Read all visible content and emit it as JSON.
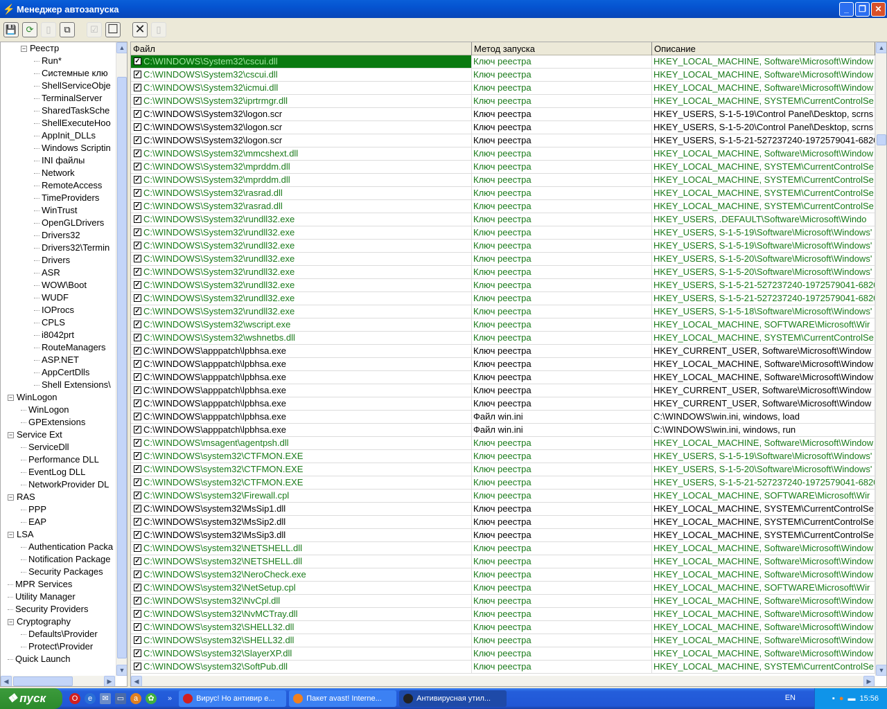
{
  "window": {
    "title": "Менеджер автозапуска",
    "controls": [
      "_",
      "❐",
      "✕"
    ]
  },
  "toolbar": {
    "icons": [
      "save-icon",
      "refresh-icon",
      "new-icon",
      "copy-icon",
      "check-icon",
      "uncheck-icon",
      "delete-icon",
      "properties-icon"
    ]
  },
  "tree": [
    {
      "label": "Реестр",
      "level": 1,
      "exp": "−"
    },
    {
      "label": "Run*",
      "level": 2
    },
    {
      "label": "Системные клю",
      "level": 2
    },
    {
      "label": "ShellServiceObje",
      "level": 2
    },
    {
      "label": "TerminalServer",
      "level": 2
    },
    {
      "label": "SharedTaskSche",
      "level": 2
    },
    {
      "label": "ShellExecuteHoo",
      "level": 2
    },
    {
      "label": "AppInit_DLLs",
      "level": 2
    },
    {
      "label": "Windows Scriptin",
      "level": 2
    },
    {
      "label": "INI файлы",
      "level": 2
    },
    {
      "label": "Network",
      "level": 2
    },
    {
      "label": "RemoteAccess",
      "level": 2
    },
    {
      "label": "TimeProviders",
      "level": 2
    },
    {
      "label": "WinTrust",
      "level": 2
    },
    {
      "label": "OpenGLDrivers",
      "level": 2
    },
    {
      "label": "Drivers32",
      "level": 2
    },
    {
      "label": "Drivers32\\Termin",
      "level": 2
    },
    {
      "label": "Drivers",
      "level": 2
    },
    {
      "label": "ASR",
      "level": 2
    },
    {
      "label": "WOW\\Boot",
      "level": 2
    },
    {
      "label": "WUDF",
      "level": 2
    },
    {
      "label": "IOProcs",
      "level": 2
    },
    {
      "label": "CPLS",
      "level": 2
    },
    {
      "label": "i8042prt",
      "level": 2
    },
    {
      "label": "RouteManagers",
      "level": 2
    },
    {
      "label": "ASP.NET",
      "level": 2
    },
    {
      "label": "AppCertDlls",
      "level": 2
    },
    {
      "label": "Shell Extensions\\",
      "level": 2
    },
    {
      "label": "WinLogon",
      "level": 0,
      "exp": "−"
    },
    {
      "label": "WinLogon",
      "level": 1
    },
    {
      "label": "GPExtensions",
      "level": 1
    },
    {
      "label": "Service Ext",
      "level": 0,
      "exp": "−"
    },
    {
      "label": "ServiceDll",
      "level": 1
    },
    {
      "label": "Performance DLL",
      "level": 1
    },
    {
      "label": "EventLog DLL",
      "level": 1
    },
    {
      "label": "NetworkProvider DL",
      "level": 1
    },
    {
      "label": "RAS",
      "level": 0,
      "exp": "−"
    },
    {
      "label": "PPP",
      "level": 1
    },
    {
      "label": "EAP",
      "level": 1
    },
    {
      "label": "LSA",
      "level": 0,
      "exp": "−"
    },
    {
      "label": "Authentication Packa",
      "level": 1
    },
    {
      "label": "Notification Package",
      "level": 1
    },
    {
      "label": "Security Packages",
      "level": 1
    },
    {
      "label": "MPR Services",
      "level": 0
    },
    {
      "label": "Utility Manager",
      "level": 0
    },
    {
      "label": "Security Providers",
      "level": 0
    },
    {
      "label": "Cryptography",
      "level": 0,
      "exp": "−"
    },
    {
      "label": "Defaults\\Provider",
      "level": 1
    },
    {
      "label": "Protect\\Provider",
      "level": 1
    },
    {
      "label": "Quick Launch",
      "level": 0
    }
  ],
  "table": {
    "columns": [
      "Файл",
      "Метод запуска",
      "Описание"
    ],
    "colors": {
      "green": "#1a7a1a",
      "selected": "#0a7a10"
    },
    "rows": [
      {
        "file": "C:\\WINDOWS\\System32\\cscui.dll",
        "method": "Ключ реестра",
        "desc": "HKEY_LOCAL_MACHINE, Software\\Microsoft\\Window",
        "g": 1,
        "sel": 1
      },
      {
        "file": "C:\\WINDOWS\\System32\\cscui.dll",
        "method": "Ключ реестра",
        "desc": "HKEY_LOCAL_MACHINE, Software\\Microsoft\\Window",
        "g": 1
      },
      {
        "file": "C:\\WINDOWS\\System32\\icmui.dll",
        "method": "Ключ реестра",
        "desc": "HKEY_LOCAL_MACHINE, Software\\Microsoft\\Window",
        "g": 1
      },
      {
        "file": "C:\\WINDOWS\\System32\\iprtrmgr.dll",
        "method": "Ключ реестра",
        "desc": "HKEY_LOCAL_MACHINE, SYSTEM\\CurrentControlSe",
        "g": 1
      },
      {
        "file": "C:\\WINDOWS\\System32\\logon.scr",
        "method": "Ключ реестра",
        "desc": "HKEY_USERS, S-1-5-19\\Control Panel\\Desktop, scrns",
        "g": 0
      },
      {
        "file": "C:\\WINDOWS\\System32\\logon.scr",
        "method": "Ключ реестра",
        "desc": "HKEY_USERS, S-1-5-20\\Control Panel\\Desktop, scrns",
        "g": 0
      },
      {
        "file": "C:\\WINDOWS\\System32\\logon.scr",
        "method": "Ключ реестра",
        "desc": "HKEY_USERS, S-1-5-21-527237240-1972579041-6820",
        "g": 0
      },
      {
        "file": "C:\\WINDOWS\\System32\\mmcshext.dll",
        "method": "Ключ реестра",
        "desc": "HKEY_LOCAL_MACHINE, Software\\Microsoft\\Window",
        "g": 1
      },
      {
        "file": "C:\\WINDOWS\\System32\\mprddm.dll",
        "method": "Ключ реестра",
        "desc": "HKEY_LOCAL_MACHINE, SYSTEM\\CurrentControlSe",
        "g": 1
      },
      {
        "file": "C:\\WINDOWS\\System32\\mprddm.dll",
        "method": "Ключ реестра",
        "desc": "HKEY_LOCAL_MACHINE, SYSTEM\\CurrentControlSe",
        "g": 1
      },
      {
        "file": "C:\\WINDOWS\\System32\\rasrad.dll",
        "method": "Ключ реестра",
        "desc": "HKEY_LOCAL_MACHINE, SYSTEM\\CurrentControlSe",
        "g": 1
      },
      {
        "file": "C:\\WINDOWS\\System32\\rasrad.dll",
        "method": "Ключ реестра",
        "desc": "HKEY_LOCAL_MACHINE, SYSTEM\\CurrentControlSe",
        "g": 1
      },
      {
        "file": "C:\\WINDOWS\\System32\\rundll32.exe",
        "method": "Ключ реестра",
        "desc": "HKEY_USERS, .DEFAULT\\Software\\Microsoft\\Windo",
        "g": 1
      },
      {
        "file": "C:\\WINDOWS\\System32\\rundll32.exe",
        "method": "Ключ реестра",
        "desc": "HKEY_USERS, S-1-5-19\\Software\\Microsoft\\Windows'",
        "g": 1
      },
      {
        "file": "C:\\WINDOWS\\System32\\rundll32.exe",
        "method": "Ключ реестра",
        "desc": "HKEY_USERS, S-1-5-19\\Software\\Microsoft\\Windows'",
        "g": 1
      },
      {
        "file": "C:\\WINDOWS\\System32\\rundll32.exe",
        "method": "Ключ реестра",
        "desc": "HKEY_USERS, S-1-5-20\\Software\\Microsoft\\Windows'",
        "g": 1
      },
      {
        "file": "C:\\WINDOWS\\System32\\rundll32.exe",
        "method": "Ключ реестра",
        "desc": "HKEY_USERS, S-1-5-20\\Software\\Microsoft\\Windows'",
        "g": 1
      },
      {
        "file": "C:\\WINDOWS\\System32\\rundll32.exe",
        "method": "Ключ реестра",
        "desc": "HKEY_USERS, S-1-5-21-527237240-1972579041-6820",
        "g": 1
      },
      {
        "file": "C:\\WINDOWS\\System32\\rundll32.exe",
        "method": "Ключ реестра",
        "desc": "HKEY_USERS, S-1-5-21-527237240-1972579041-6820",
        "g": 1
      },
      {
        "file": "C:\\WINDOWS\\System32\\rundll32.exe",
        "method": "Ключ реестра",
        "desc": "HKEY_USERS, S-1-5-18\\Software\\Microsoft\\Windows'",
        "g": 1
      },
      {
        "file": "C:\\WINDOWS\\System32\\wscript.exe",
        "method": "Ключ реестра",
        "desc": "HKEY_LOCAL_MACHINE, SOFTWARE\\Microsoft\\Wir",
        "g": 1
      },
      {
        "file": "C:\\WINDOWS\\System32\\wshnetbs.dll",
        "method": "Ключ реестра",
        "desc": "HKEY_LOCAL_MACHINE, SYSTEM\\CurrentControlSe",
        "g": 1
      },
      {
        "file": "C:\\WINDOWS\\apppatch\\lpbhsa.exe",
        "method": "Ключ реестра",
        "desc": "HKEY_CURRENT_USER, Software\\Microsoft\\Window",
        "g": 0
      },
      {
        "file": "C:\\WINDOWS\\apppatch\\lpbhsa.exe",
        "method": "Ключ реестра",
        "desc": "HKEY_LOCAL_MACHINE, Software\\Microsoft\\Window",
        "g": 0
      },
      {
        "file": "C:\\WINDOWS\\apppatch\\lpbhsa.exe",
        "method": "Ключ реестра",
        "desc": "HKEY_LOCAL_MACHINE, Software\\Microsoft\\Window",
        "g": 0
      },
      {
        "file": "C:\\WINDOWS\\apppatch\\lpbhsa.exe",
        "method": "Ключ реестра",
        "desc": "HKEY_CURRENT_USER, Software\\Microsoft\\Window",
        "g": 0
      },
      {
        "file": "C:\\WINDOWS\\apppatch\\lpbhsa.exe",
        "method": "Ключ реестра",
        "desc": "HKEY_CURRENT_USER, Software\\Microsoft\\Window",
        "g": 0
      },
      {
        "file": "C:\\WINDOWS\\apppatch\\lpbhsa.exe",
        "method": "Файл win.ini",
        "desc": "C:\\WINDOWS\\win.ini, windows, load",
        "g": 0
      },
      {
        "file": "C:\\WINDOWS\\apppatch\\lpbhsa.exe",
        "method": "Файл win.ini",
        "desc": "C:\\WINDOWS\\win.ini, windows, run",
        "g": 0
      },
      {
        "file": "C:\\WINDOWS\\msagent\\agentpsh.dll",
        "method": "Ключ реестра",
        "desc": "HKEY_LOCAL_MACHINE, Software\\Microsoft\\Window",
        "g": 1
      },
      {
        "file": "C:\\WINDOWS\\system32\\CTFMON.EXE",
        "method": "Ключ реестра",
        "desc": "HKEY_USERS, S-1-5-19\\Software\\Microsoft\\Windows'",
        "g": 1
      },
      {
        "file": "C:\\WINDOWS\\system32\\CTFMON.EXE",
        "method": "Ключ реестра",
        "desc": "HKEY_USERS, S-1-5-20\\Software\\Microsoft\\Windows'",
        "g": 1
      },
      {
        "file": "C:\\WINDOWS\\system32\\CTFMON.EXE",
        "method": "Ключ реестра",
        "desc": "HKEY_USERS, S-1-5-21-527237240-1972579041-6820",
        "g": 1
      },
      {
        "file": "C:\\WINDOWS\\system32\\Firewall.cpl",
        "method": "Ключ реестра",
        "desc": "HKEY_LOCAL_MACHINE, SOFTWARE\\Microsoft\\Wir",
        "g": 1
      },
      {
        "file": "C:\\WINDOWS\\system32\\MsSip1.dll",
        "method": "Ключ реестра",
        "desc": "HKEY_LOCAL_MACHINE, SYSTEM\\CurrentControlSe",
        "g": 0
      },
      {
        "file": "C:\\WINDOWS\\system32\\MsSip2.dll",
        "method": "Ключ реестра",
        "desc": "HKEY_LOCAL_MACHINE, SYSTEM\\CurrentControlSe",
        "g": 0
      },
      {
        "file": "C:\\WINDOWS\\system32\\MsSip3.dll",
        "method": "Ключ реестра",
        "desc": "HKEY_LOCAL_MACHINE, SYSTEM\\CurrentControlSe",
        "g": 0
      },
      {
        "file": "C:\\WINDOWS\\system32\\NETSHELL.dll",
        "method": "Ключ реестра",
        "desc": "HKEY_LOCAL_MACHINE, Software\\Microsoft\\Window",
        "g": 1
      },
      {
        "file": "C:\\WINDOWS\\system32\\NETSHELL.dll",
        "method": "Ключ реестра",
        "desc": "HKEY_LOCAL_MACHINE, Software\\Microsoft\\Window",
        "g": 1
      },
      {
        "file": "C:\\WINDOWS\\system32\\NeroCheck.exe",
        "method": "Ключ реестра",
        "desc": "HKEY_LOCAL_MACHINE, Software\\Microsoft\\Window",
        "g": 1
      },
      {
        "file": "C:\\WINDOWS\\system32\\NetSetup.cpl",
        "method": "Ключ реестра",
        "desc": "HKEY_LOCAL_MACHINE, SOFTWARE\\Microsoft\\Wir",
        "g": 1
      },
      {
        "file": "C:\\WINDOWS\\system32\\NvCpl.dll",
        "method": "Ключ реестра",
        "desc": "HKEY_LOCAL_MACHINE, Software\\Microsoft\\Window",
        "g": 1
      },
      {
        "file": "C:\\WINDOWS\\system32\\NvMCTray.dll",
        "method": "Ключ реестра",
        "desc": "HKEY_LOCAL_MACHINE, Software\\Microsoft\\Window",
        "g": 1
      },
      {
        "file": "C:\\WINDOWS\\system32\\SHELL32.dll",
        "method": "Ключ реестра",
        "desc": "HKEY_LOCAL_MACHINE, Software\\Microsoft\\Window",
        "g": 1
      },
      {
        "file": "C:\\WINDOWS\\system32\\SHELL32.dll",
        "method": "Ключ реестра",
        "desc": "HKEY_LOCAL_MACHINE, Software\\Microsoft\\Window",
        "g": 1
      },
      {
        "file": "C:\\WINDOWS\\system32\\SlayerXP.dll",
        "method": "Ключ реестра",
        "desc": "HKEY_LOCAL_MACHINE, Software\\Microsoft\\Window",
        "g": 1
      },
      {
        "file": "C:\\WINDOWS\\system32\\SoftPub.dll",
        "method": "Ключ реестра",
        "desc": "HKEY_LOCAL_MACHINE, SYSTEM\\CurrentControlSe",
        "g": 1
      }
    ]
  },
  "taskbar": {
    "start": "пуск",
    "tasks": [
      {
        "label": "Вирус! Но антивир е...",
        "color": "#d02020"
      },
      {
        "label": "Пакет avast! Interne...",
        "color": "#f08020"
      },
      {
        "label": "Антивирусная утил...",
        "color": "#222222",
        "active": 1
      }
    ],
    "lang": "EN",
    "clock": "15:56"
  }
}
